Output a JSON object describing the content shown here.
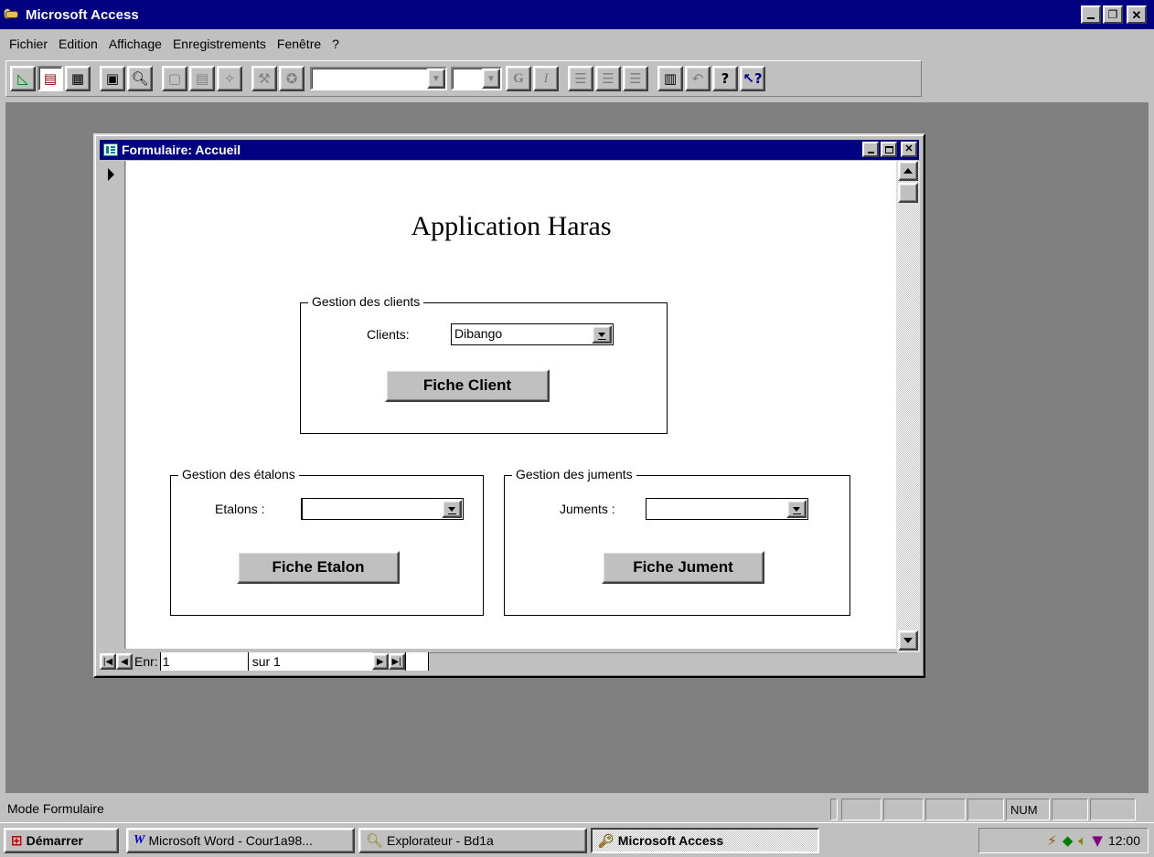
{
  "app": {
    "title": "Microsoft Access"
  },
  "menu": [
    {
      "label": "Fichier"
    },
    {
      "label": "Edition"
    },
    {
      "label": "Affichage"
    },
    {
      "label": "Enregistrements"
    },
    {
      "label": "Fenêtre"
    },
    {
      "label": "?"
    }
  ],
  "toolbar": {
    "bold_label": "G",
    "italic_label": "I"
  },
  "form": {
    "window_title": "Formulaire: Accueil",
    "heading": "Application Haras",
    "clients_group": {
      "legend": "Gestion des clients",
      "label": "Clients:",
      "value": "Dibango",
      "button": "Fiche Client"
    },
    "etalons_group": {
      "legend": "Gestion des étalons",
      "label": "Etalons :",
      "value": "",
      "button": "Fiche Etalon"
    },
    "juments_group": {
      "legend": "Gestion des juments",
      "label": "Juments :",
      "value": "",
      "button": "Fiche Jument"
    },
    "navigation": {
      "record_label": "Enr:",
      "record_value": "1",
      "total_label": "sur 1"
    }
  },
  "status": {
    "text": "Mode Formulaire",
    "num": "NUM"
  },
  "taskbar": {
    "start": "Démarrer",
    "items": [
      {
        "label": "Microsoft Word - Cour1a98..."
      },
      {
        "label": "Explorateur - Bd1a"
      },
      {
        "label": "Microsoft Access"
      }
    ],
    "clock": "12:00"
  },
  "colors": {
    "titlebar": "#000080",
    "desktop_mdi": "#808080",
    "face": "#c0c0c0"
  }
}
